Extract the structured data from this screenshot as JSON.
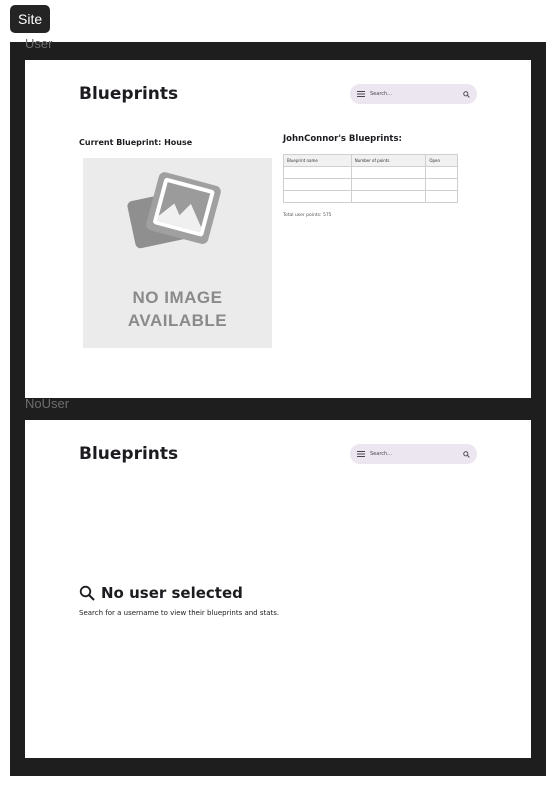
{
  "site_tag": "Site",
  "frames": {
    "user": {
      "label": "User",
      "brand": "Blueprints",
      "search_placeholder": "Search...",
      "current_blueprint": "Current Blueprint: House",
      "no_image_line1": "NO IMAGE",
      "no_image_line2": "AVAILABLE",
      "user_blueprints_title": "JohnConnor's Blueprints:",
      "table": {
        "headers": [
          "Blueprint name",
          "Number of points",
          "Open"
        ],
        "rows": [
          [
            "",
            "",
            ""
          ],
          [
            "",
            "",
            ""
          ],
          [
            "",
            "",
            ""
          ]
        ]
      },
      "total_points": "Total user points: 575"
    },
    "nouser": {
      "label": "NoUser",
      "brand": "Blueprints",
      "search_placeholder": "Search...",
      "heading": "No user selected",
      "description": "Search for a username to view their blueprints and stats."
    }
  },
  "icons": {
    "menu": "menu-icon",
    "search": "search-icon",
    "placeholder_image": "image-placeholder-icon",
    "magnifier": "magnifier-icon"
  },
  "colors": {
    "canvas": "#1e1e1e",
    "search_bar": "#ece6f0",
    "text": "#1d1b20",
    "placeholder_bg": "#ebebeb"
  }
}
